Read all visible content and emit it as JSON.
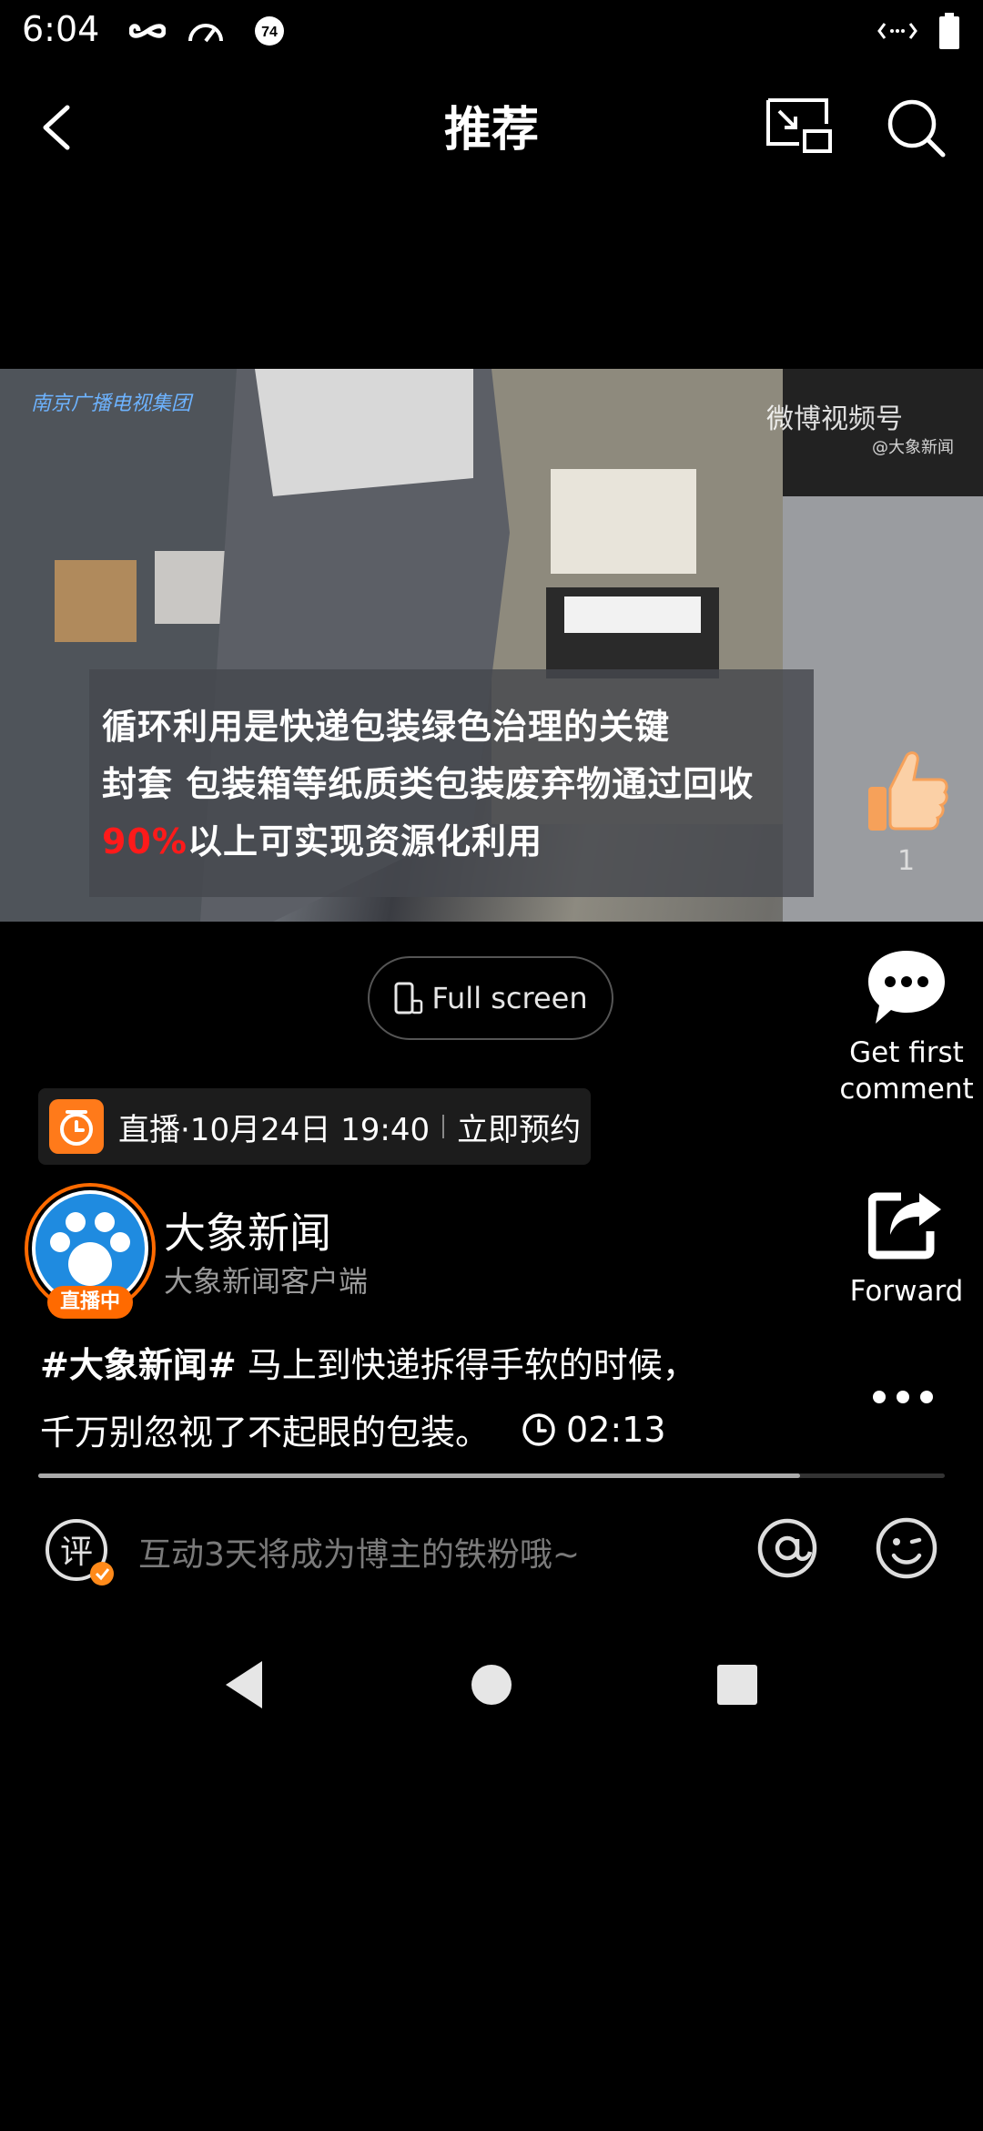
{
  "status_bar": {
    "time": "6:04",
    "icons": [
      "infinity-icon",
      "speedometer-icon",
      "notification-74-icon",
      "data-sync-icon",
      "battery-icon"
    ],
    "badge_number": "74"
  },
  "header": {
    "title": "推荐",
    "back_icon": "back-arrow-icon",
    "pip_icon": "picture-in-picture-icon",
    "search_icon": "search-icon"
  },
  "video": {
    "watermark_left": "南京广播电视集团",
    "watermark_right": "微博视频号",
    "watermark_right_sub": "@大象新闻",
    "caption_lines": [
      "循环利用是快递包装绿色治理的关键",
      "封套 包装箱等纸质类包装废弃物通过回收"
    ],
    "caption_red": "90%",
    "caption_line3_rest": "以上可实现资源化利用"
  },
  "actions": {
    "like_count": "1",
    "full_screen_label": "Full screen",
    "comment_label_1": "Get first",
    "comment_label_2": "comment",
    "forward_label": "Forward"
  },
  "live_banner": {
    "text": "直播·10月24日 19:40",
    "action": "立即预约"
  },
  "author": {
    "name": "大象新闻",
    "subtitle": "大象新闻客户端",
    "live_badge": "直播中"
  },
  "post": {
    "hashtag": "#大象新闻#",
    "text_line1": " 马上到快递拆得手软的时候，",
    "text_line2": "千万别忽视了不起眼的包装。",
    "duration": "02:13",
    "progress": 0.84
  },
  "comment_bar": {
    "placeholder": "互动3天将成为博主的铁粉哦~",
    "badge_char": "评"
  },
  "colors": {
    "background": "#000000",
    "accent_orange": "#ff6a00",
    "caption_red": "#ff1a1a"
  }
}
